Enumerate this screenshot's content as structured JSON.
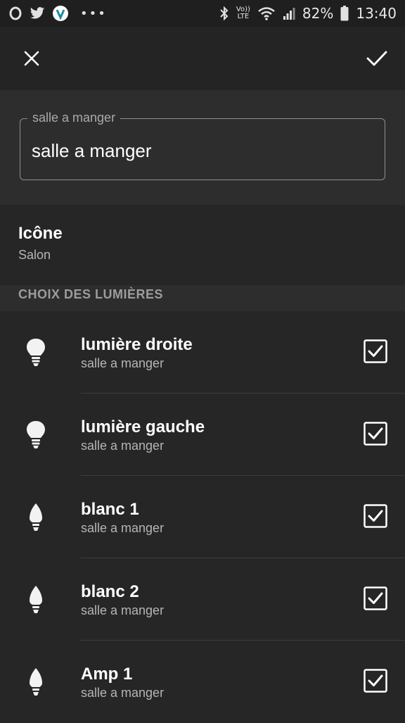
{
  "status_bar": {
    "left_icons": [
      "opera-icon",
      "twitter-icon",
      "vivino-icon",
      "more-notifications-icon"
    ],
    "right_icons": [
      "bluetooth-icon",
      "volte-icon",
      "wifi-icon",
      "signal-icon",
      "battery-icon"
    ],
    "volte_top": "Vo))",
    "volte_bottom": "LTE",
    "battery": "82%",
    "time": "13:40"
  },
  "app_bar": {
    "close_icon": "close-icon",
    "confirm_icon": "check-icon"
  },
  "name_field": {
    "label": "salle a manger",
    "value": "salle a manger"
  },
  "icon_setting": {
    "title": "Icône",
    "value": "Salon"
  },
  "lights_section": {
    "header": "CHOIX DES LUMIÈRES",
    "lights": [
      {
        "name": "lumière droite",
        "room": "salle a manger",
        "bulb": "bulb-icon",
        "checked": true
      },
      {
        "name": "lumière gauche",
        "room": "salle a manger",
        "bulb": "bulb-icon",
        "checked": true
      },
      {
        "name": "blanc 1",
        "room": "salle a manger",
        "bulb": "candle-bulb-icon",
        "checked": true
      },
      {
        "name": "blanc 2",
        "room": "salle a manger",
        "bulb": "candle-bulb-icon",
        "checked": true
      },
      {
        "name": "Amp 1",
        "room": "salle a manger",
        "bulb": "candle-bulb-icon",
        "checked": true
      }
    ]
  },
  "colors": {
    "background": "#262626",
    "surface": "#2d2d2d",
    "text_primary": "#ffffff",
    "text_secondary": "#b5b5b5"
  }
}
